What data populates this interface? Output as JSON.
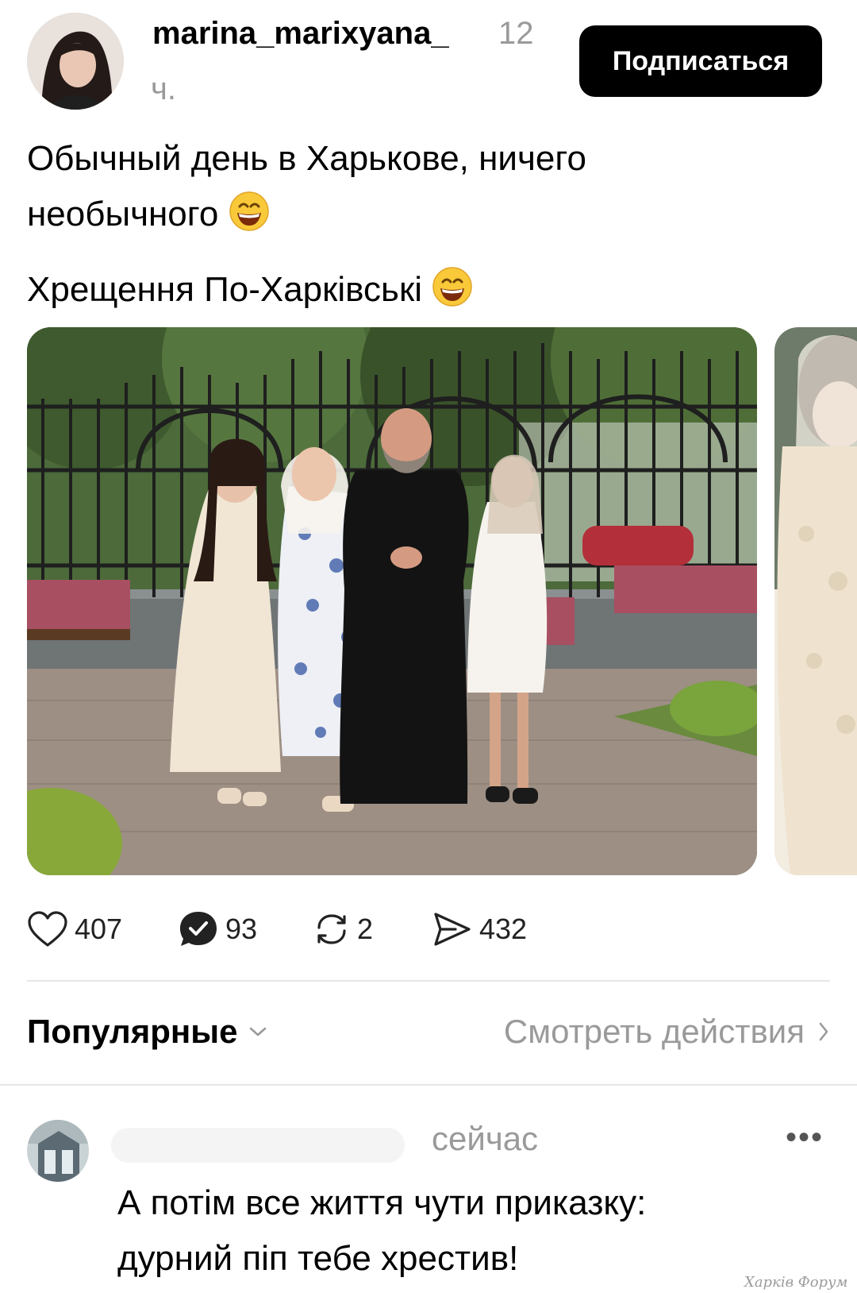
{
  "post": {
    "username": "marina_marixyana_",
    "time_part1": "12",
    "time_part2": "ч.",
    "subscribe_label": "Подписаться",
    "caption_line1": "Обычный день в Харькове, ничего",
    "caption_line2": "необычного",
    "caption_line3": "Хрещення По-Харківські",
    "emoji_icon": "grinning-smiling-eyes-emoji",
    "stats": {
      "likes": "407",
      "comments": "93",
      "reposts": "2",
      "shares": "432"
    }
  },
  "sort": {
    "label": "Популярные",
    "activity_label": "Смотреть действия"
  },
  "comment": {
    "time": "сейчас",
    "more": "•••",
    "text_line1": "А потім все життя чути приказку:",
    "text_line2": "дурний піп тебе хрестив!"
  },
  "watermark": "Харків Форум",
  "colors": {
    "subscribe_bg": "#000000",
    "muted_text": "#9a9a9a",
    "divider": "#e6e6e6"
  }
}
